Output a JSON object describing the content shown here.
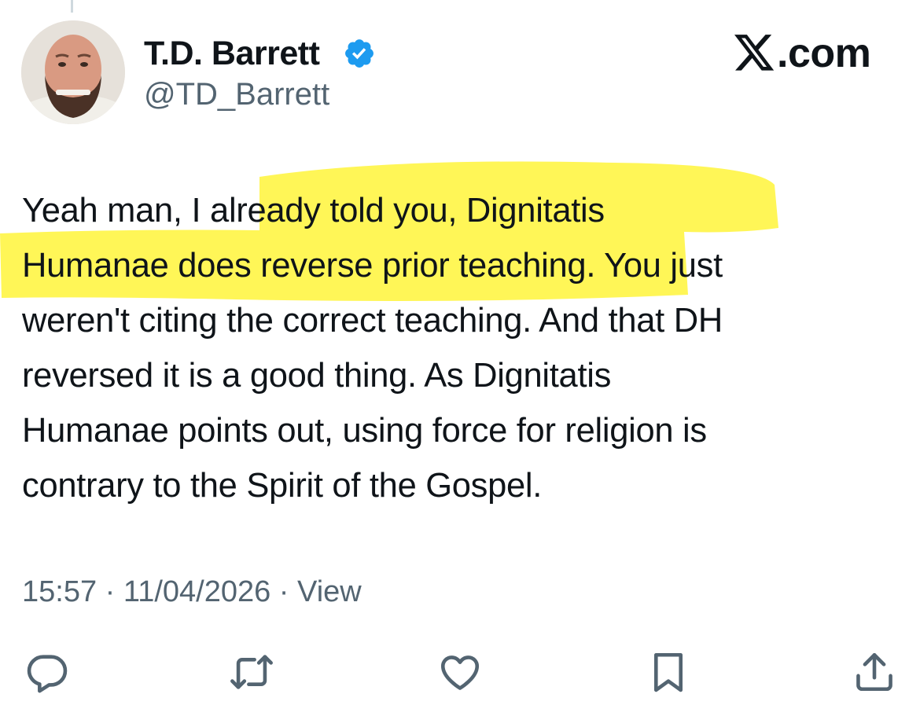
{
  "author": {
    "display_name": "T.D. Barrett",
    "handle": "@TD_Barrett",
    "verified_icon": "verified-badge-icon",
    "avatar": "avatar-photo"
  },
  "brand": {
    "label": ".com",
    "icon": "x-logo-icon"
  },
  "tweet": {
    "lines": [
      "Yeah man, I already told you, Dignitatis",
      "Humanae does reverse prior teaching. You just",
      "weren't citing the correct teaching.  And that DH",
      "reversed it is a good thing. As Dignitatis",
      "Humanae points out, using force for religion is",
      "contrary to the Spirit of the Gospel."
    ],
    "highlighted_text": "already told you, Dignitatis Humanae does reverse prior teaching"
  },
  "meta": {
    "time": "15:57",
    "separator": " · ",
    "date": "11/04/2026",
    "views_label": "View"
  },
  "actions": [
    {
      "name": "reply",
      "icon": "reply-icon"
    },
    {
      "name": "retweet",
      "icon": "retweet-icon"
    },
    {
      "name": "like",
      "icon": "like-icon"
    },
    {
      "name": "bookmark",
      "icon": "bookmark-icon"
    },
    {
      "name": "share",
      "icon": "share-icon"
    }
  ],
  "colors": {
    "text": "#0f1419",
    "secondary_text": "#536471",
    "verified_blue": "#1d9bf0",
    "highlight_yellow": "#fff53a"
  }
}
